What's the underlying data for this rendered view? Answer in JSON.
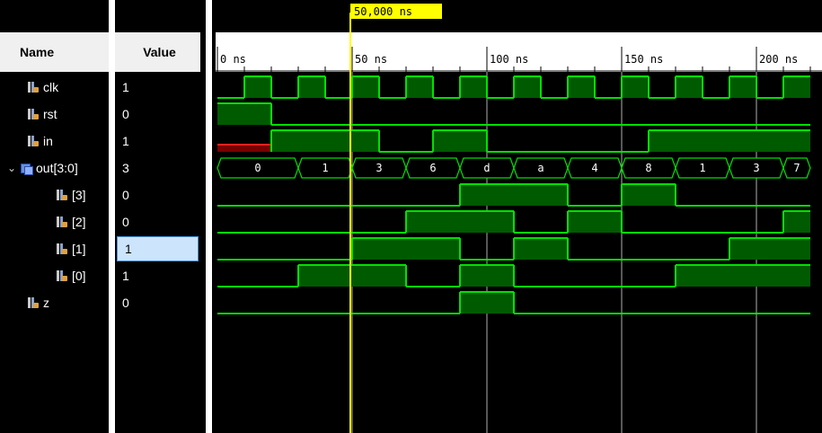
{
  "headers": {
    "name": "Name",
    "value": "Value"
  },
  "cursor": {
    "label": "50,000 ns",
    "time_ns": 50
  },
  "time_axis": {
    "start_ns": 0,
    "labels": [
      {
        "t": 0,
        "text": "0 ns"
      },
      {
        "t": 50,
        "text": "50 ns"
      },
      {
        "t": 100,
        "text": "100 ns"
      },
      {
        "t": 150,
        "text": "150 ns"
      },
      {
        "t": 200,
        "text": "200 ns"
      }
    ]
  },
  "signals": [
    {
      "id": "clk",
      "name": "clk",
      "value": "1",
      "indent": 0,
      "kind": "bit",
      "segs": [
        [
          0,
          10,
          0
        ],
        [
          10,
          20,
          1
        ],
        [
          20,
          30,
          0
        ],
        [
          30,
          40,
          1
        ],
        [
          40,
          50,
          0
        ],
        [
          50,
          60,
          1
        ],
        [
          60,
          70,
          0
        ],
        [
          70,
          80,
          1
        ],
        [
          80,
          90,
          0
        ],
        [
          90,
          100,
          1
        ],
        [
          100,
          110,
          0
        ],
        [
          110,
          120,
          1
        ],
        [
          120,
          130,
          0
        ],
        [
          130,
          140,
          1
        ],
        [
          140,
          150,
          0
        ],
        [
          150,
          160,
          1
        ],
        [
          160,
          170,
          0
        ],
        [
          170,
          180,
          1
        ],
        [
          180,
          190,
          0
        ],
        [
          190,
          200,
          1
        ],
        [
          200,
          210,
          0
        ],
        [
          210,
          220,
          1
        ]
      ]
    },
    {
      "id": "rst",
      "name": "rst",
      "value": "0",
      "indent": 0,
      "kind": "bit",
      "segs": [
        [
          0,
          20,
          1
        ],
        [
          20,
          220,
          0
        ]
      ]
    },
    {
      "id": "in",
      "name": "in",
      "value": "1",
      "indent": 0,
      "kind": "bit",
      "segs": [
        [
          0,
          20,
          "x"
        ],
        [
          20,
          60,
          1
        ],
        [
          60,
          80,
          0
        ],
        [
          80,
          100,
          1
        ],
        [
          100,
          160,
          0
        ],
        [
          160,
          220,
          1
        ]
      ]
    },
    {
      "id": "out",
      "name": "out[3:0]",
      "value": "3",
      "indent": 0,
      "kind": "bus",
      "expanded": true,
      "segs": [
        [
          0,
          30,
          "0"
        ],
        [
          30,
          50,
          "1"
        ],
        [
          50,
          70,
          "3"
        ],
        [
          70,
          90,
          "6"
        ],
        [
          90,
          110,
          "d"
        ],
        [
          110,
          130,
          "a"
        ],
        [
          130,
          150,
          "4"
        ],
        [
          150,
          170,
          "8"
        ],
        [
          170,
          190,
          "1"
        ],
        [
          190,
          210,
          "3"
        ],
        [
          210,
          220,
          "7"
        ]
      ]
    },
    {
      "id": "out3",
      "name": "[3]",
      "value": "0",
      "indent": 1,
      "kind": "bit",
      "segs": [
        [
          0,
          90,
          0
        ],
        [
          90,
          130,
          1
        ],
        [
          130,
          150,
          0
        ],
        [
          150,
          170,
          1
        ],
        [
          170,
          220,
          0
        ]
      ]
    },
    {
      "id": "out2",
      "name": "[2]",
      "value": "0",
      "indent": 1,
      "kind": "bit",
      "segs": [
        [
          0,
          70,
          0
        ],
        [
          70,
          110,
          1
        ],
        [
          110,
          130,
          0
        ],
        [
          130,
          150,
          1
        ],
        [
          150,
          210,
          0
        ],
        [
          210,
          220,
          1
        ]
      ]
    },
    {
      "id": "out1",
      "name": "[1]",
      "value": "1",
      "indent": 1,
      "kind": "bit",
      "selected": true,
      "segs": [
        [
          0,
          50,
          0
        ],
        [
          50,
          90,
          1
        ],
        [
          90,
          110,
          0
        ],
        [
          110,
          130,
          1
        ],
        [
          130,
          190,
          0
        ],
        [
          190,
          220,
          1
        ]
      ]
    },
    {
      "id": "out0",
      "name": "[0]",
      "value": "1",
      "indent": 1,
      "kind": "bit",
      "segs": [
        [
          0,
          30,
          0
        ],
        [
          30,
          70,
          1
        ],
        [
          70,
          90,
          0
        ],
        [
          90,
          110,
          1
        ],
        [
          110,
          170,
          0
        ],
        [
          170,
          220,
          1
        ]
      ]
    },
    {
      "id": "z",
      "name": "z",
      "value": "0",
      "indent": 0,
      "kind": "bit",
      "segs": [
        [
          0,
          90,
          0
        ],
        [
          90,
          110,
          1
        ],
        [
          110,
          220,
          0
        ]
      ]
    }
  ],
  "colors": {
    "wave": "#00e000",
    "wave_fill": "#005a00",
    "unknown": "#ff2020",
    "unknown_fill": "#7a0000",
    "cursor": "#ffff00",
    "grid": "#b0b0b0",
    "axis_text": "#ffffff"
  }
}
